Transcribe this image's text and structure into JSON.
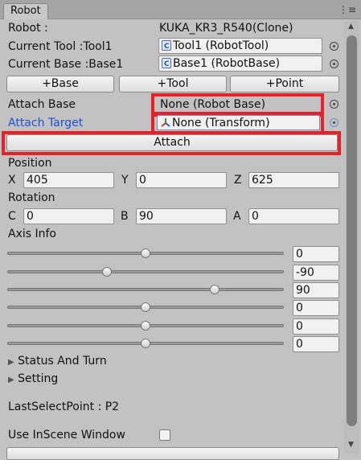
{
  "tab": {
    "title": "Robot"
  },
  "robot": {
    "label": "Robot :",
    "value": "KUKA_KR3_R540(Clone)"
  },
  "current_tool": {
    "label": "Current Tool :Tool1",
    "value": "Tool1 (RobotTool)",
    "icon": "component-icon"
  },
  "current_base": {
    "label": "Current Base :Base1",
    "value": "Base1 (RobotBase)",
    "icon": "component-icon"
  },
  "buttons": {
    "add_base": "+Base",
    "add_tool": "+Tool",
    "add_point": "+Point",
    "attach": "Attach"
  },
  "attach_base": {
    "label": "Attach Base",
    "value": "None (Robot Base)"
  },
  "attach_target": {
    "label": "Attach Target",
    "value": "None (Transform)",
    "icon": "transform-icon",
    "label_color": "#1f4fd8"
  },
  "position": {
    "label": "Position",
    "x_label": "X",
    "x": "405",
    "y_label": "Y",
    "y": "0",
    "z_label": "Z",
    "z": "625"
  },
  "rotation": {
    "label": "Rotation",
    "c_label": "C",
    "c": "0",
    "b_label": "B",
    "b": "90",
    "a_label": "A",
    "a": "0"
  },
  "axis_info": {
    "label": "Axis Info",
    "axes": [
      {
        "value": "0",
        "level": 0.5
      },
      {
        "value": "-90",
        "level": 0.36
      },
      {
        "value": "90",
        "level": 0.75
      },
      {
        "value": "0",
        "level": 0.5
      },
      {
        "value": "0",
        "level": 0.5
      },
      {
        "value": "0",
        "level": 0.5
      }
    ]
  },
  "sections": {
    "status_and_turn": "Status And Turn",
    "setting": "Setting"
  },
  "last_select_point": "LastSelectPoint : P2",
  "use_inscene_window": {
    "label": "Use InScene Window",
    "checked": false
  },
  "colors": {
    "highlight": "#e8202a",
    "link_blue": "#1f4fd8"
  }
}
